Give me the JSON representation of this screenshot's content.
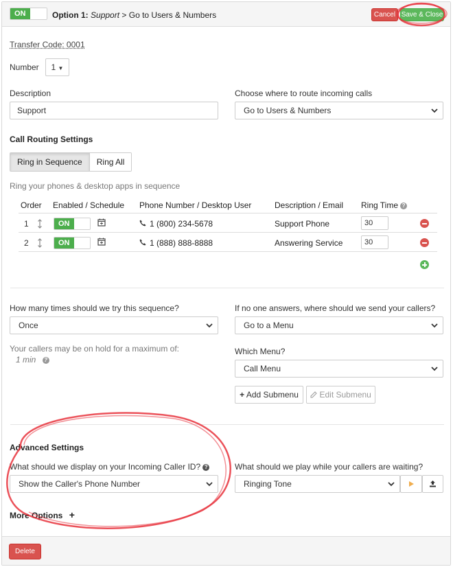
{
  "header": {
    "toggle_label": "ON",
    "option_label": "Option 1:",
    "option_name": "Support",
    "option_arrow": ">",
    "option_target": "Go to Users & Numbers",
    "cancel_label": "Cancel",
    "save_close_label": "Save & Close"
  },
  "form": {
    "transfer_code": "Transfer Code: 0001",
    "number_label": "Number",
    "number_value": "1",
    "description_label": "Description",
    "description_value": "Support",
    "route_label": "Choose where to route incoming calls",
    "route_value": "Go to Users & Numbers"
  },
  "routing": {
    "title": "Call Routing Settings",
    "tabs": [
      "Ring in Sequence",
      "Ring All"
    ],
    "active_tab": "Ring in Sequence",
    "hint": "Ring your phones & desktop apps in sequence",
    "columns": {
      "order": "Order",
      "enabled": "Enabled / Schedule",
      "phone": "Phone Number / Desktop User",
      "description": "Description / Email",
      "ring_time": "Ring Time"
    },
    "rows": [
      {
        "order": "1",
        "enabled": "ON",
        "phone": "1 (800) 234-5678",
        "description": "Support Phone",
        "ring_time": "30"
      },
      {
        "order": "2",
        "enabled": "ON",
        "phone": "1 (888) 888-8888",
        "description": "Answering Service",
        "ring_time": "30"
      }
    ]
  },
  "sequence": {
    "tries_label": "How many times should we try this sequence?",
    "tries_value": "Once",
    "hold_label": "Your callers may be on hold for a maximum of:",
    "hold_value": "1 min",
    "no_answer_label": "If no one answers, where should we send your callers?",
    "no_answer_value": "Go to a Menu",
    "menu_label": "Which Menu?",
    "menu_value": "Call Menu",
    "add_submenu": "Add Submenu",
    "edit_submenu": "Edit Submenu"
  },
  "advanced": {
    "title": "Advanced Settings",
    "caller_id_label": "What should we display on your Incoming Caller ID?",
    "caller_id_value": "Show the Caller's Phone Number",
    "hold_music_label": "What should we play while your callers are waiting?",
    "hold_music_value": "Ringing Tone",
    "more_options": "More Options"
  },
  "footer": {
    "delete_label": "Delete"
  },
  "colors": {
    "on_green": "#4cae4c",
    "danger_red": "#d9534f",
    "success_green": "#5cb85c",
    "play_orange": "#f0ad4e",
    "annotation_red": "#e8323c"
  },
  "icons": [
    "chevron-down-icon",
    "drag-handle-icon",
    "calendar-icon",
    "phone-icon",
    "remove-icon",
    "add-icon",
    "help-icon",
    "plus-icon",
    "edit-icon",
    "play-icon",
    "upload-icon"
  ]
}
